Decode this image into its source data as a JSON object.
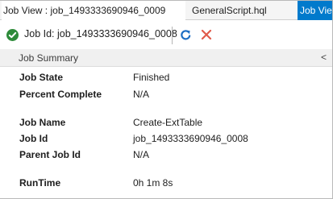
{
  "tabs": [
    {
      "label": "Job View : job_1493333690946_0009"
    },
    {
      "label": "GeneralScript.hql"
    },
    {
      "label": "Job View"
    }
  ],
  "toolbar": {
    "job_id_label": "Job Id: job_1493333690946_0008",
    "status_icon": "success-check-icon",
    "refresh_icon": "refresh-icon",
    "cancel_icon": "close-icon",
    "colors": {
      "success": "#2e8b3a",
      "refresh": "#1e6fc4",
      "cancel": "#e05a4a",
      "active_tab": "#007acc"
    }
  },
  "summary": {
    "title": "Job Summary",
    "collapse_glyph": "<",
    "properties": [
      {
        "label": "Job State",
        "value": "Finished"
      },
      {
        "label": "Percent Complete",
        "value": "N/A"
      },
      {
        "label": "Job Name",
        "value": "Create-ExtTable"
      },
      {
        "label": "Job Id",
        "value": "job_1493333690946_0008"
      },
      {
        "label": "Parent Job Id",
        "value": "N/A"
      },
      {
        "label": "RunTime",
        "value": "0h 1m 8s"
      }
    ]
  }
}
